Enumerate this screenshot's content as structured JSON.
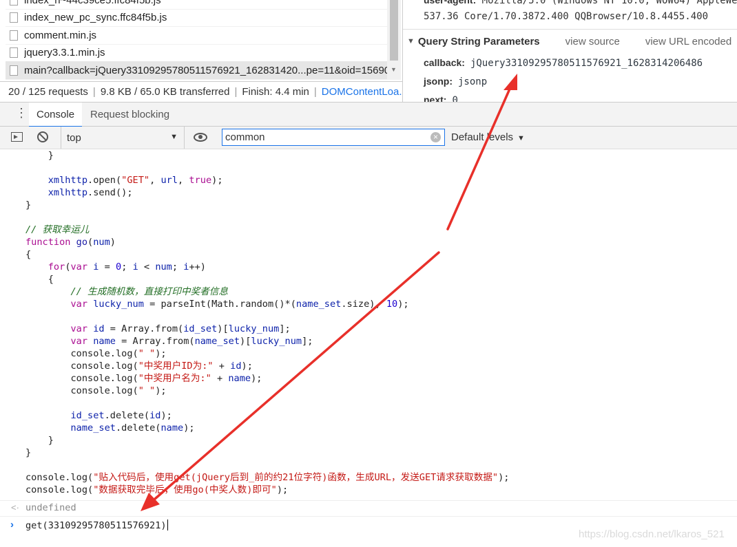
{
  "network": {
    "files": [
      {
        "name": "index_n~44c39ce5.ffc84f5b.js",
        "selected": false
      },
      {
        "name": "index_new_pc_sync.ffc84f5b.js",
        "selected": false
      },
      {
        "name": "comment.min.js",
        "selected": false
      },
      {
        "name": "jquery3.3.1.min.js",
        "selected": false
      },
      {
        "name": "main?callback=jQuery33109295780511576921_162831420...pe=11&oid=15690...",
        "selected": true
      }
    ],
    "status": {
      "requests": "20 / 125 requests",
      "transferred": "9.8 KB / 65.0 KB transferred",
      "finish": "Finish: 4.4 min",
      "domcontent": "DOMContentLoa..."
    }
  },
  "headers": {
    "ua_key": "user-agent:",
    "ua_value_1": "Mozilla/5.0 (Windows NT 10.0; WOW64) AppleWeb",
    "ua_value_2": "537.36 Core/1.70.3872.400 QQBrowser/10.8.4455.400",
    "query_params": {
      "title": "Query String Parameters",
      "view_source": "view source",
      "view_url_encoded": "view URL encoded",
      "params": [
        {
          "key": "callback:",
          "value": "jQuery33109295780511576921_1628314206486"
        },
        {
          "key": "jsonp:",
          "value": "jsonp"
        },
        {
          "key": "next:",
          "value": "0"
        }
      ]
    }
  },
  "drawer": {
    "tabs": [
      "Console",
      "Request blocking"
    ],
    "active_tab": "Console"
  },
  "toolbar": {
    "context": "top",
    "filter_value": "common",
    "levels": "Default levels"
  },
  "console": {
    "code_lines": [
      "    }",
      "",
      "    xmlhttp.open(\"GET\", url, true);",
      "    xmlhttp.send();",
      "}",
      "",
      "// 获取幸运儿",
      "function go(num)",
      "{",
      "    for(var i = 0; i < num; i++)",
      "    {",
      "        // 生成随机数，直接打印中奖者信息",
      "        var lucky_num = parseInt(Math.random()*(name_set.size), 10);",
      "",
      "        var id = Array.from(id_set)[lucky_num];",
      "        var name = Array.from(name_set)[lucky_num];",
      "        console.log(\" \");",
      "        console.log(\"中奖用户ID为:\" + id);",
      "        console.log(\"中奖用户名为:\" + name);",
      "        console.log(\" \");",
      "",
      "        id_set.delete(id);",
      "        name_set.delete(name);",
      "    }",
      "}",
      "",
      "console.log(\"贴入代码后，使用get(jQuery后到_前的约21位字符)函数，生成URL，发送GET请求获取数据\");",
      "console.log(\"数据获取完毕后，使用go(中奖人数)即可\");"
    ],
    "result": "undefined",
    "prompt_input": "get(33109295780511576921)"
  },
  "watermark": "https://blog.csdn.net/lkaros_521",
  "colors": {
    "accent": "#1a73e8",
    "annotation_arrow": "#e8302a"
  }
}
